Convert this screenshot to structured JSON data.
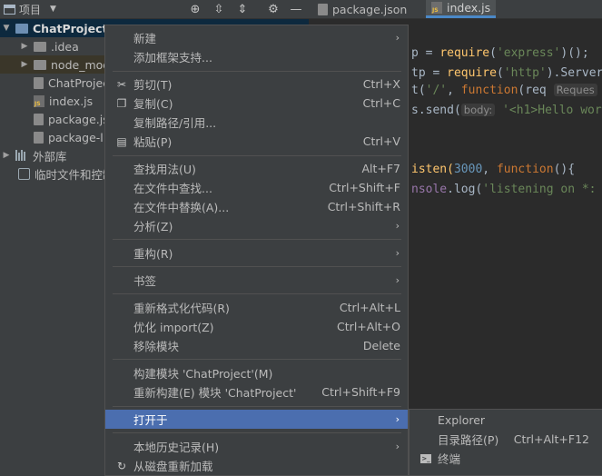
{
  "toolbar": {
    "project_label": "项目",
    "tabs": [
      {
        "label": "package.json"
      },
      {
        "label": "index.js"
      }
    ]
  },
  "tree": {
    "items": [
      {
        "label": "ChatProject"
      },
      {
        "label": ".idea"
      },
      {
        "label": "node_mod"
      },
      {
        "label": "ChatProjec"
      },
      {
        "label": "index.js"
      },
      {
        "label": "package.js"
      },
      {
        "label": "package-l"
      },
      {
        "label": "外部库"
      },
      {
        "label": "临时文件和控制"
      }
    ]
  },
  "editor": {
    "lines": [
      {
        "a": "p = ",
        "b": "require",
        "c": "(",
        "d": "'express'",
        "e": ")();"
      },
      {
        "a": "tp = ",
        "b": "require",
        "c": "(",
        "d": "'http'",
        "e": ").Server"
      },
      {
        "a": "t(",
        "b": "'/'",
        "c": ", ",
        "d": "function",
        "e": "(req",
        "hint": "Reques"
      },
      {
        "a": "s.send(",
        "hint": "body:",
        "d": "'<h1>Hello wor"
      },
      {
        "a": "isten(",
        "n": "3000",
        "c": ", ",
        "d": "function",
        "e": "(){"
      },
      {
        "a": "nsole",
        "b": ".log(",
        "d": "'listening on *:"
      }
    ]
  },
  "menu": {
    "items": [
      {
        "label": "新建",
        "shortcut": ""
      },
      {
        "label": "添加框架支持...",
        "shortcut": ""
      },
      {
        "label": "剪切(T)",
        "shortcut": "Ctrl+X"
      },
      {
        "label": "复制(C)",
        "shortcut": "Ctrl+C"
      },
      {
        "label": "复制路径/引用...",
        "shortcut": ""
      },
      {
        "label": "粘贴(P)",
        "shortcut": "Ctrl+V"
      },
      {
        "label": "查找用法(U)",
        "shortcut": "Alt+F7"
      },
      {
        "label": "在文件中查找...",
        "shortcut": "Ctrl+Shift+F"
      },
      {
        "label": "在文件中替换(A)...",
        "shortcut": "Ctrl+Shift+R"
      },
      {
        "label": "分析(Z)",
        "shortcut": ""
      },
      {
        "label": "重构(R)",
        "shortcut": ""
      },
      {
        "label": "书签",
        "shortcut": ""
      },
      {
        "label": "重新格式化代码(R)",
        "shortcut": "Ctrl+Alt+L"
      },
      {
        "label": "优化 import(Z)",
        "shortcut": "Ctrl+Alt+O"
      },
      {
        "label": "移除模块",
        "shortcut": "Delete"
      },
      {
        "label": "构建模块 'ChatProject'(M)",
        "shortcut": ""
      },
      {
        "label": "重新构建(E) 模块 'ChatProject'",
        "shortcut": "Ctrl+Shift+F9"
      },
      {
        "label": "打开于",
        "shortcut": ""
      },
      {
        "label": "本地历史记录(H)",
        "shortcut": ""
      },
      {
        "label": "从磁盘重新加载",
        "shortcut": ""
      }
    ]
  },
  "submenu": {
    "items": [
      {
        "label": "Explorer",
        "shortcut": ""
      },
      {
        "label": "目录路径(P)",
        "shortcut": "Ctrl+Alt+F12"
      },
      {
        "label": "终端",
        "shortcut": ""
      }
    ]
  }
}
